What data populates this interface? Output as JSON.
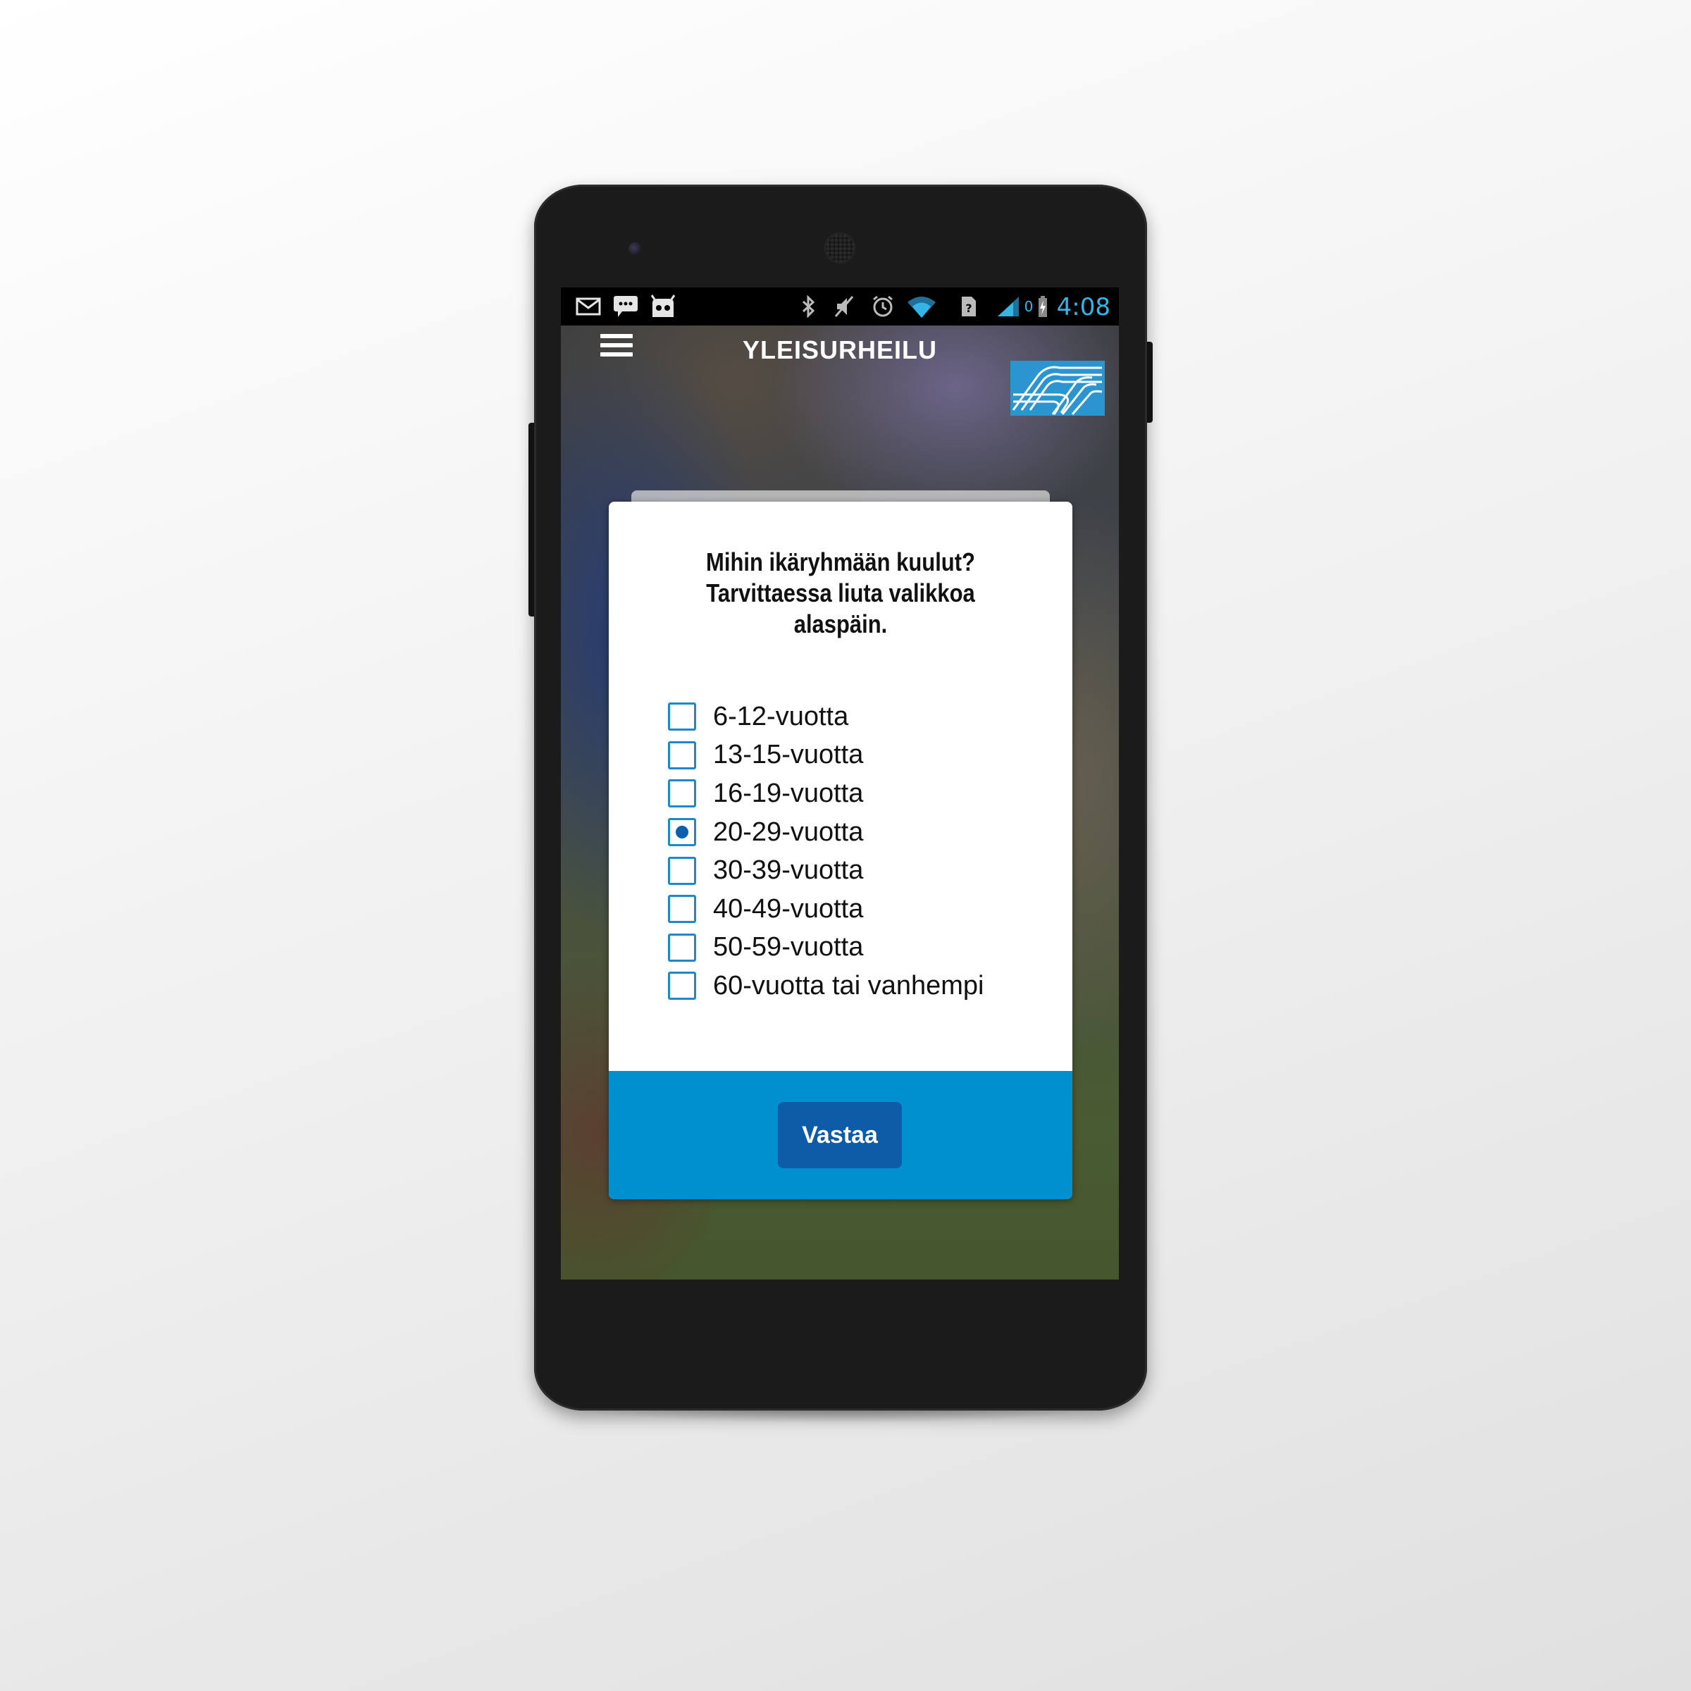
{
  "statusbar": {
    "time": "4:08",
    "battery_text": "0",
    "icons": [
      "mail-icon",
      "chat-icon",
      "cyanogenmod-icon",
      "bluetooth-icon",
      "mute-icon",
      "alarm-icon",
      "wifi-icon",
      "sim-icon",
      "signal-icon",
      "battery-icon"
    ]
  },
  "appbar": {
    "title": "YLEISURHEILU",
    "menu_icon": "hamburger-menu-icon",
    "logo": "yleisurheilu-logo"
  },
  "dialog": {
    "question": "Mihin ikäryhmään kuulut? Tarvittaessa liuta valikkoa alaspäin.",
    "options": [
      {
        "label": "6-12-vuotta",
        "checked": false
      },
      {
        "label": "13-15-vuotta",
        "checked": false
      },
      {
        "label": "16-19-vuotta",
        "checked": false
      },
      {
        "label": "20-29-vuotta",
        "checked": true
      },
      {
        "label": "30-39-vuotta",
        "checked": false
      },
      {
        "label": "40-49-vuotta",
        "checked": false
      },
      {
        "label": "50-59-vuotta",
        "checked": false
      },
      {
        "label": "60-vuotta tai vanhempi",
        "checked": false
      }
    ],
    "submit_label": "Vastaa"
  },
  "colors": {
    "accent": "#008fcf",
    "button": "#0e5ca8",
    "checkbox_border": "#1f88c8",
    "status_time": "#33b5e5"
  }
}
